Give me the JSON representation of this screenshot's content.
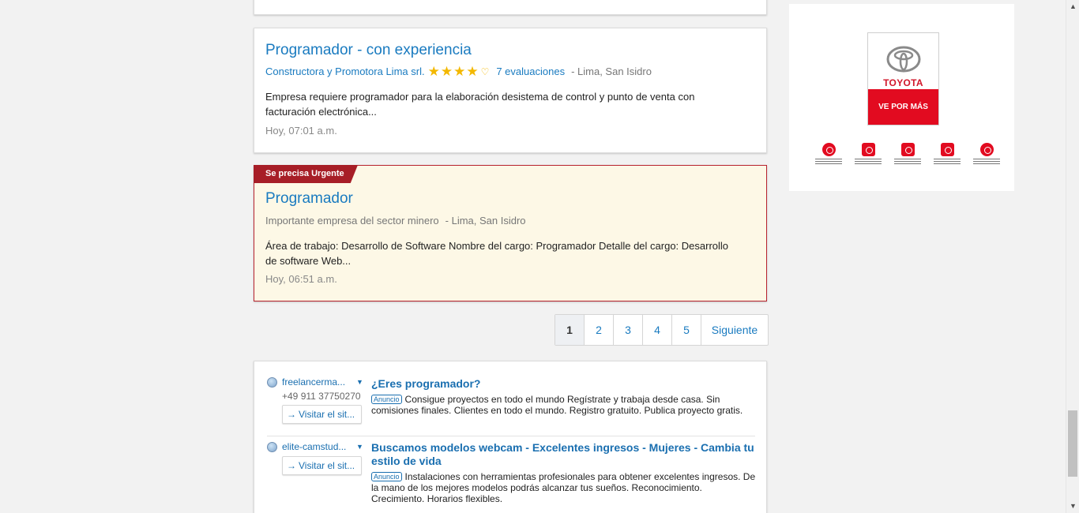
{
  "jobs": [
    {
      "title": "Programador - con experiencia",
      "company": "Constructora y Promotora Lima srl.",
      "rating": 4,
      "rating_max": 5,
      "reviews": "7 evaluaciones",
      "location": "- Lima, San Isidro",
      "description": "Empresa requiere programador para la elaboración desistema de control y punto de venta con facturación electrónica...",
      "date": "Hoy, 07:01 a.m."
    },
    {
      "badge": "Se precisa Urgente",
      "title": "Programador",
      "company": "Importante empresa del sector minero",
      "location": "- Lima, San Isidro",
      "description": "Área de trabajo: Desarrollo de Software Nombre del cargo: Programador Detalle del cargo: Desarrollo de software Web...",
      "date": "Hoy, 06:51 a.m."
    }
  ],
  "pagination": {
    "pages": [
      "1",
      "2",
      "3",
      "4",
      "5"
    ],
    "current": "1",
    "next": "Siguiente"
  },
  "ads": [
    {
      "domain": "freelancerma...",
      "phone": "+49 911 37750270",
      "visit": "Visitar el sit...",
      "headline": "¿Eres programador?",
      "label": "Anuncio",
      "body": "Consigue proyectos en todo el mundo Regístrate y trabaja desde casa. Sin comisiones finales. Clientes en todo el mundo. Registro gratuito. Publica proyecto gratis."
    },
    {
      "domain": "elite-camstud...",
      "visit": "Visitar el sit...",
      "headline": "Buscamos modelos webcam - Excelentes ingresos - Mujeres - Cambia tu estilo de vida",
      "label": "Anuncio",
      "body": "Instalaciones con herramientas profesionales para obtener excelentes ingresos. De la mano de los mejores modelos podrás alcanzar tus sueños. Reconocimiento. Crecimiento. Horarios flexibles."
    }
  ],
  "banner": {
    "brand": "TOYOTA",
    "tagline": "VE POR MÁS",
    "brand_color": "#e20b20"
  },
  "colors": {
    "link": "#1a7bc0",
    "urgent": "#a71e27",
    "urgent_bg": "#fdf8e6",
    "star": "#f3b800"
  }
}
